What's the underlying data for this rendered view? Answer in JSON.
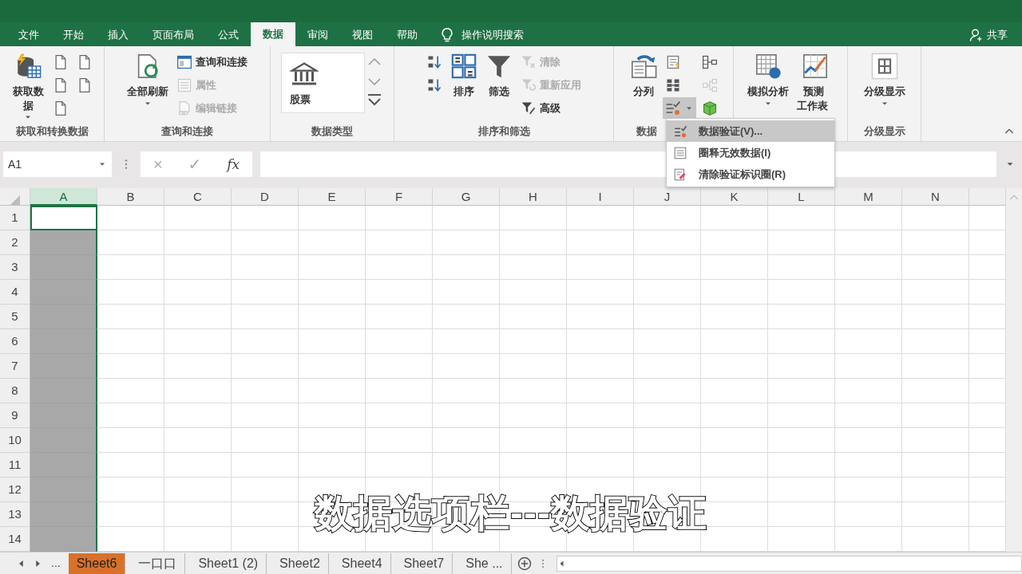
{
  "ribbon_tabs": [
    {
      "label": "文件",
      "selected": false
    },
    {
      "label": "开始",
      "selected": false
    },
    {
      "label": "插入",
      "selected": false
    },
    {
      "label": "页面布局",
      "selected": false
    },
    {
      "label": "公式",
      "selected": false
    },
    {
      "label": "数据",
      "selected": true
    },
    {
      "label": "审阅",
      "selected": false
    },
    {
      "label": "视图",
      "selected": false
    },
    {
      "label": "帮助",
      "selected": false
    }
  ],
  "tell_me": "操作说明搜索",
  "share": "共享",
  "ribbon_groups": [
    {
      "label": "获取和转换数据",
      "columns": [
        {
          "kind": "large",
          "label": "获取数据",
          "dropdown": true
        },
        {
          "kind": "stack",
          "buttons": [
            {
              "disabled": false,
              "pressed": false
            },
            {
              "disabled": false,
              "pressed": false
            },
            {
              "disabled": false,
              "pressed": false
            }
          ]
        },
        {
          "kind": "stack",
          "buttons": [
            {
              "disabled": false,
              "pressed": false
            },
            {
              "disabled": false,
              "pressed": false
            }
          ]
        }
      ]
    },
    {
      "label": "查询和连接",
      "columns": [
        {
          "kind": "large",
          "label": "全部刷新",
          "dropdown": true
        },
        {
          "kind": "stack",
          "buttons": [
            {
              "label": "查询和连接",
              "disabled": false,
              "pressed": false
            },
            {
              "label": "属性",
              "disabled": true,
              "pressed": false
            },
            {
              "label": "编辑链接",
              "disabled": true,
              "pressed": false
            }
          ]
        }
      ]
    },
    {
      "label": "数据类型",
      "columns": [
        {
          "kind": "gallery",
          "label": "股票"
        }
      ]
    },
    {
      "label": "排序和筛选",
      "columns": [
        {
          "kind": "stack",
          "buttons": [
            {
              "disabled": false,
              "pressed": false
            },
            {
              "disabled": false,
              "pressed": false
            }
          ]
        },
        {
          "kind": "large",
          "label": "排序",
          "dropdown": false
        },
        {
          "kind": "large",
          "label": "筛选",
          "dropdown": false
        },
        {
          "kind": "stack",
          "buttons": [
            {
              "label": "清除",
              "disabled": true,
              "pressed": false
            },
            {
              "label": "重新应用",
              "disabled": true,
              "pressed": false
            },
            {
              "label": "高级",
              "disabled": false,
              "pressed": false
            }
          ]
        }
      ]
    },
    {
      "label": "数据",
      "columns": [
        {
          "kind": "large",
          "label": "分列",
          "dropdown": false
        },
        {
          "kind": "stack",
          "buttons": [
            {
              "disabled": false,
              "pressed": false
            },
            {
              "disabled": false,
              "pressed": false
            },
            {
              "disabled": false,
              "pressed": true
            }
          ]
        },
        {
          "kind": "stack",
          "buttons": [
            {
              "disabled": false,
              "pressed": false
            },
            {
              "disabled": true,
              "pressed": false
            },
            {
              "disabled": false,
              "pressed": false
            }
          ]
        }
      ]
    },
    {
      "columns": [
        {
          "kind": "large",
          "label": "模拟分析",
          "dropdown": true
        },
        {
          "kind": "large",
          "label": "预测工作表",
          "dropdown": false
        }
      ]
    },
    {
      "label": "分级显示",
      "columns": [
        {
          "kind": "large",
          "label": "分级显示",
          "dropdown": true
        }
      ]
    }
  ],
  "validation_menu": [
    {
      "label": "数据验证(V)...",
      "selected": true
    },
    {
      "label": "圈释无效数据(I)",
      "selected": false
    },
    {
      "label": "清除验证标识圈(R)",
      "selected": false
    }
  ],
  "name_box": "A1",
  "formula_buttons": [
    "×",
    "✓",
    "fx"
  ],
  "columns": [
    {
      "label": "A",
      "selected": true
    },
    {
      "label": "B",
      "selected": false
    },
    {
      "label": "C",
      "selected": false
    },
    {
      "label": "D",
      "selected": false
    },
    {
      "label": "E",
      "selected": false
    },
    {
      "label": "F",
      "selected": false
    },
    {
      "label": "G",
      "selected": false
    },
    {
      "label": "H",
      "selected": false
    },
    {
      "label": "I",
      "selected": false
    },
    {
      "label": "J",
      "selected": false
    },
    {
      "label": "K",
      "selected": false
    },
    {
      "label": "L",
      "selected": false
    },
    {
      "label": "M",
      "selected": false
    },
    {
      "label": "N",
      "selected": false
    }
  ],
  "rows": [
    {
      "label": "1",
      "active": true
    },
    {
      "label": "2",
      "active": false
    },
    {
      "label": "3",
      "active": false
    },
    {
      "label": "4",
      "active": false
    },
    {
      "label": "5",
      "active": false
    },
    {
      "label": "6",
      "active": false
    },
    {
      "label": "7",
      "active": false
    },
    {
      "label": "8",
      "active": false
    },
    {
      "label": "9",
      "active": false
    },
    {
      "label": "10",
      "active": false
    },
    {
      "label": "11",
      "active": false
    },
    {
      "label": "12",
      "active": false
    },
    {
      "label": "13",
      "active": false
    },
    {
      "label": "14",
      "active": false
    }
  ],
  "sheet_nav_more": "...",
  "sheet_tabs": [
    {
      "label": "Sheet6",
      "selected": true
    },
    {
      "label": "一口口",
      "selected": false
    },
    {
      "label": "Sheet1 (2)",
      "selected": false
    },
    {
      "label": "Sheet2",
      "selected": false
    },
    {
      "label": "Sheet4",
      "selected": false
    },
    {
      "label": "Sheet7",
      "selected": false
    },
    {
      "label": "She ...",
      "selected": false
    }
  ],
  "caption": "数据选项栏---数据验证"
}
